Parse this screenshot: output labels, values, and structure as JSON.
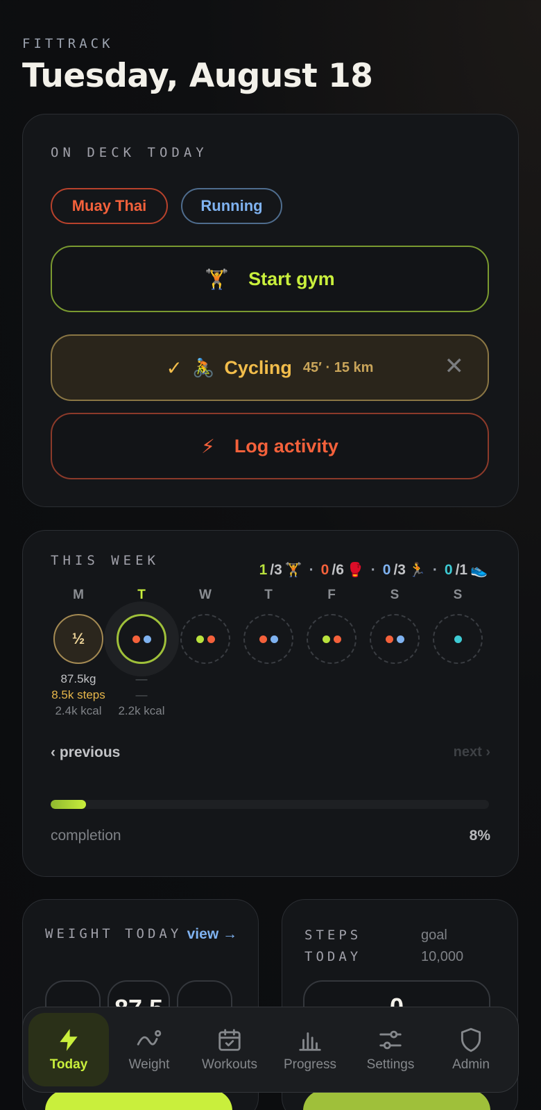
{
  "app": {
    "name": "FITTRACK",
    "date_title": "Tuesday, August 18"
  },
  "colors": {
    "accent_green": "#c9ef3c",
    "accent_red": "#f4613b",
    "accent_blue": "#7fb2f0",
    "accent_amber": "#f2bd4b",
    "accent_teal": "#3ecbd4"
  },
  "on_deck": {
    "label": "ON DECK TODAY",
    "chips": [
      "Muay Thai",
      "Running"
    ],
    "start_gym": {
      "icon": "🏋️",
      "label": "Start gym"
    },
    "cycling": {
      "check": "✓",
      "icon": "🚴",
      "label": "Cycling",
      "meta": "45′ · 15 km",
      "close": "✕"
    },
    "log_activity": {
      "icon": "⚡",
      "label": "Log activity"
    }
  },
  "week": {
    "label": "THIS WEEK",
    "summary": [
      {
        "done": "1",
        "total": "/3",
        "icon": "🏋️"
      },
      {
        "done": "0",
        "total": "/6",
        "icon": "🥊"
      },
      {
        "done": "0",
        "total": "/3",
        "icon": "🏃"
      },
      {
        "done": "0",
        "total": "/1",
        "icon": "👟"
      }
    ],
    "sep": "·",
    "days": [
      {
        "letter": "M",
        "ring_text": "½",
        "weight": "87.5kg",
        "steps": "8.5k steps",
        "kcal": "2.4k kcal"
      },
      {
        "letter": "T",
        "weight": "—",
        "steps": "—",
        "kcal": "2.2k kcal"
      },
      {
        "letter": "W"
      },
      {
        "letter": "T"
      },
      {
        "letter": "F"
      },
      {
        "letter": "S"
      },
      {
        "letter": "S"
      }
    ],
    "prev": "‹ previous",
    "next": "next ›",
    "completion_label": "completion",
    "completion_value": "8%",
    "completion_fraction": 0.08
  },
  "weight_today": {
    "label": "WEIGHT TODAY",
    "view": "view →",
    "value": "87.5"
  },
  "steps_today": {
    "label": "STEPS TODAY",
    "goal_label": "goal",
    "goal_value": "10,000",
    "value": "0"
  },
  "nav": {
    "items": [
      {
        "label": "Today",
        "icon": "bolt-icon"
      },
      {
        "label": "Weight",
        "icon": "scale-trend-icon"
      },
      {
        "label": "Workouts",
        "icon": "calendar-check-icon"
      },
      {
        "label": "Progress",
        "icon": "bar-chart-icon"
      },
      {
        "label": "Settings",
        "icon": "sliders-icon"
      },
      {
        "label": "Admin",
        "icon": "shield-icon"
      }
    ]
  }
}
